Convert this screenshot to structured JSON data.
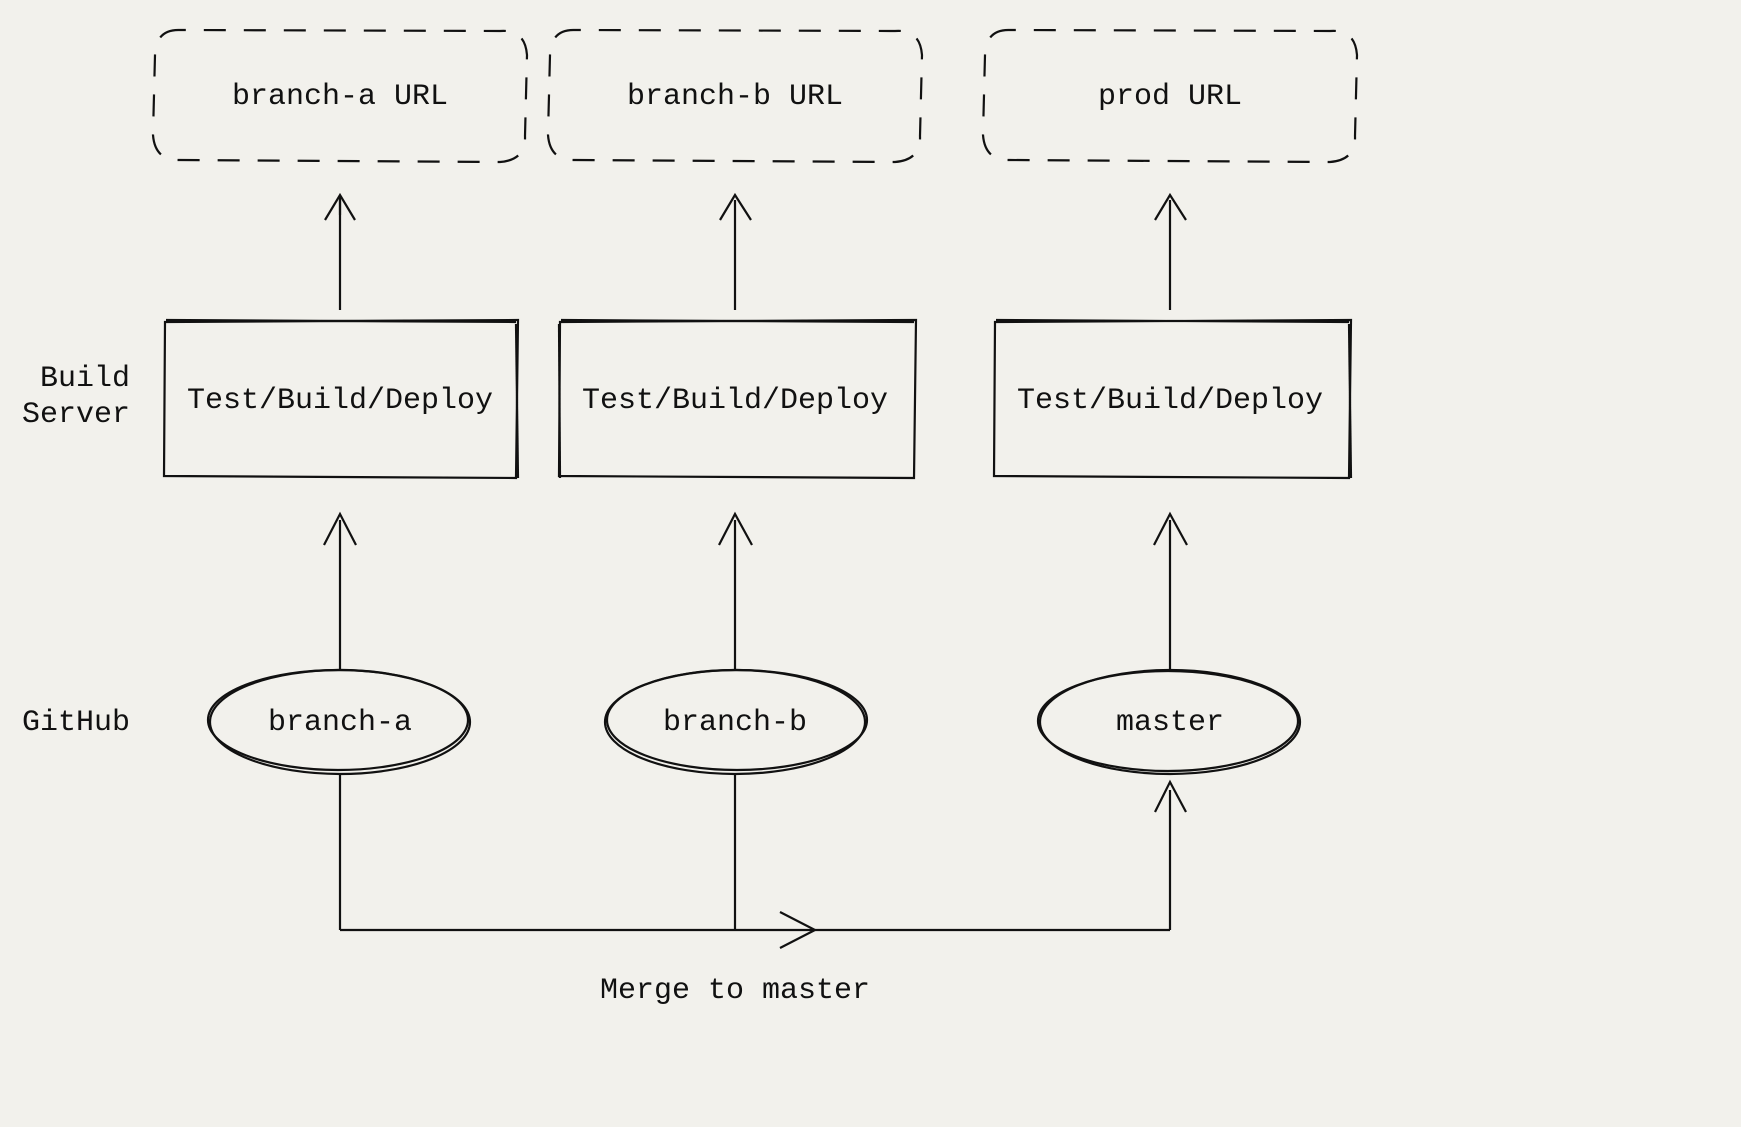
{
  "labels": {
    "build_server": "Build Server",
    "github": "GitHub",
    "merge_to_master": "Merge to master"
  },
  "columns": [
    {
      "url_label": "branch-a URL",
      "build_label": "Test/Build/Deploy",
      "branch_label": "branch-a"
    },
    {
      "url_label": "branch-b URL",
      "build_label": "Test/Build/Deploy",
      "branch_label": "branch-b"
    },
    {
      "url_label": "prod URL",
      "build_label": "Test/Build/Deploy",
      "branch_label": "master"
    }
  ]
}
